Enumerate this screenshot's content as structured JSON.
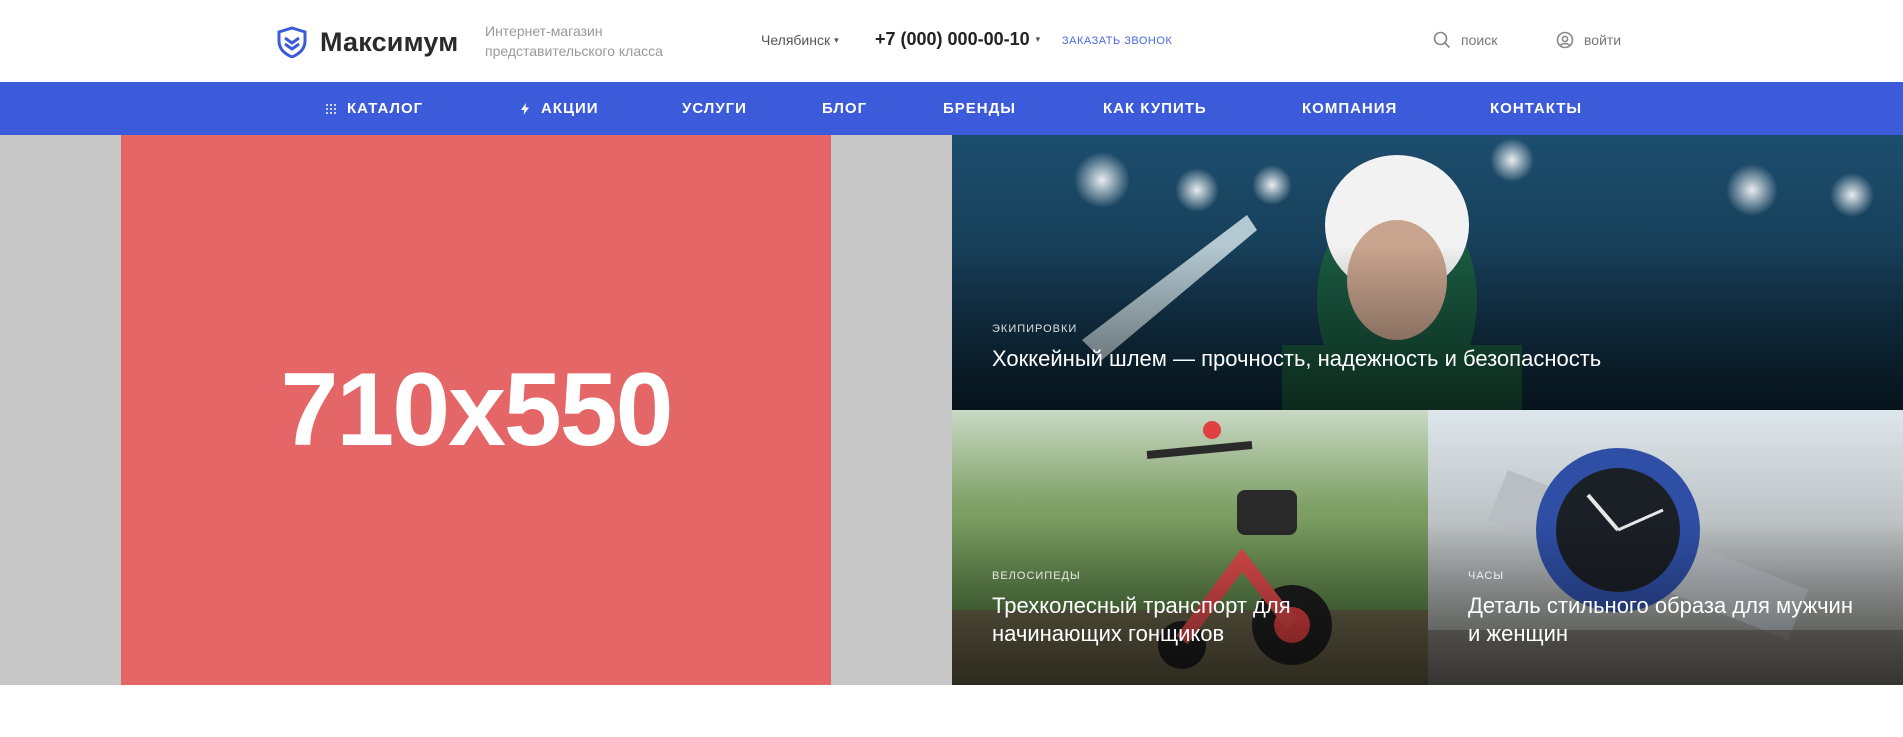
{
  "header": {
    "logo_text": "Максимум",
    "tagline_line1": "Интернет-магазин",
    "tagline_line2": "представительского класса",
    "city": "Челябинск",
    "phone": "+7 (000) 000-00-10",
    "callback": "ЗАКАЗАТЬ ЗВОНОК",
    "search_label": "поиск",
    "login_label": "войти"
  },
  "nav": {
    "items": [
      {
        "label": "КАТАЛОГ",
        "icon": "grid-icon"
      },
      {
        "label": "АКЦИИ",
        "icon": "lightning-icon"
      },
      {
        "label": "УСЛУГИ"
      },
      {
        "label": "БЛОГ"
      },
      {
        "label": "БРЕНДЫ"
      },
      {
        "label": "КАК КУПИТЬ"
      },
      {
        "label": "КОМПАНИЯ"
      },
      {
        "label": "КОНТАКТЫ"
      }
    ]
  },
  "banner": {
    "placeholder": "710x550",
    "tiles": [
      {
        "category": "ЭКИПИРОВКИ",
        "title": "Хоккейный шлем — прочность, надежность и безопасность"
      },
      {
        "category": "ВЕЛОСИПЕДЫ",
        "title_line1": "Трехколесный транспорт для",
        "title_line2": "начинающих гонщиков"
      },
      {
        "category": "ЧАСЫ",
        "title_line1": "Деталь стильного образа для мужчин",
        "title_line2": "и женщин"
      }
    ]
  },
  "colors": {
    "accent": "#3b5bdb",
    "placeholder_bg": "#e56666",
    "banner_gray": "#c8c8c8",
    "callback": "#4a69e0"
  }
}
